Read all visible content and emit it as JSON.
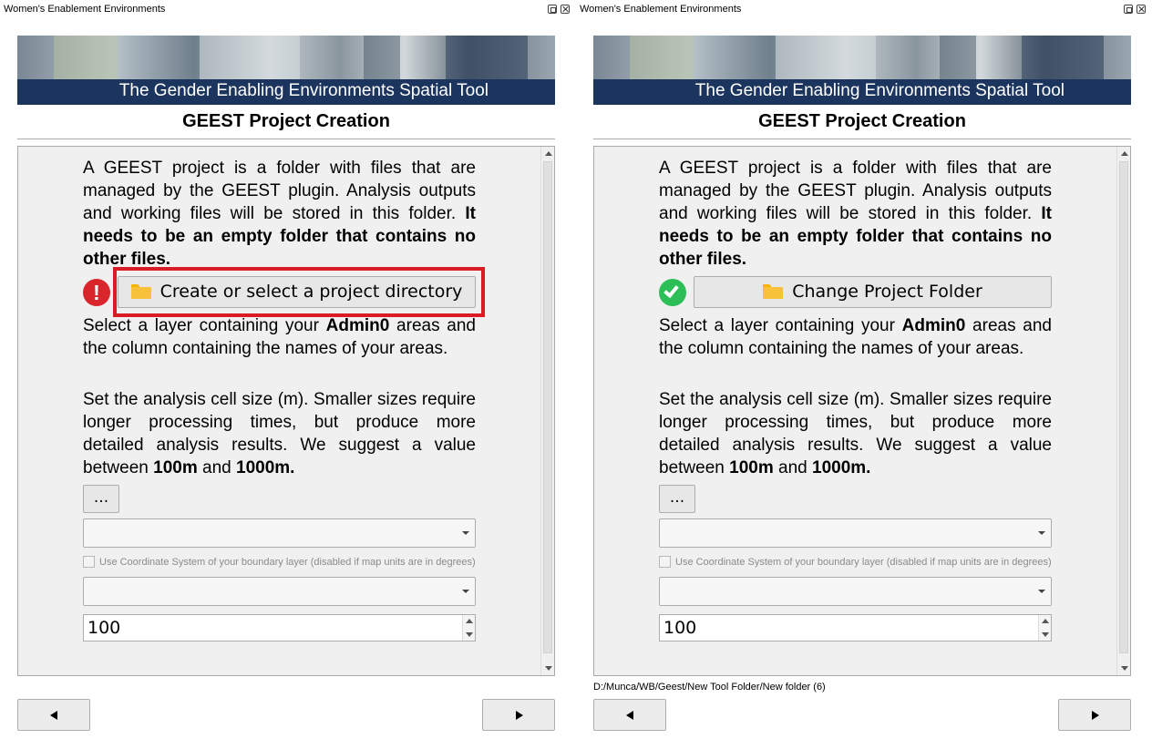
{
  "window_title": "Women's Enablement Environments",
  "banner_text": "The Gender Enabling Environments Spatial Tool",
  "heading": "GEEST Project Creation",
  "intro": {
    "text": "A GEEST project is a folder with files that are managed by the GEEST plugin. Analysis outputs and working files will be stored in this folder. ",
    "bold": "It needs to be an empty folder that contains no other files."
  },
  "admin": {
    "pre": "Select a layer containing your ",
    "bold": "Admin0",
    "post": " areas and the column containing the names of your areas."
  },
  "cellsize": {
    "pre": "Set the analysis cell size (m). Smaller sizes require longer processing times, but produce more detailed analysis results. We suggest a value between ",
    "bold1": "100m",
    "mid": " and ",
    "bold2": "1000m."
  },
  "dots_button": "...",
  "crs_checkbox_label": "Use Coordinate System of your boundary layer (disabled if map units are in degrees)",
  "cell_size_value": "100",
  "left_panel": {
    "status": "error",
    "status_mark": "!",
    "project_button": "Create or select a project directory",
    "highlight_color": "#dc1c24"
  },
  "right_panel": {
    "status": "ok",
    "project_button": "Change Project Folder",
    "selected_path": "D:/Munca/WB/Geest/New Tool Folder/New folder (6)"
  },
  "nav": {
    "prev_icon": "triangle-left-icon",
    "next_icon": "triangle-right-icon"
  },
  "colors": {
    "banner_bar": "#1c355e",
    "error": "#d9262c",
    "ok": "#2dbe58",
    "folder": "#f7c23a"
  }
}
